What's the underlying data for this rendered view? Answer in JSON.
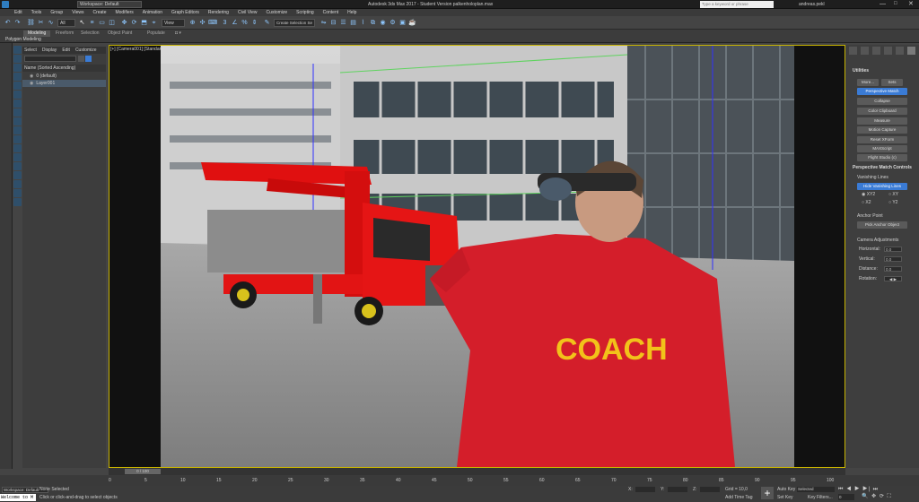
{
  "app": {
    "title": "Autodesk 3ds Max 2017 - Student Version    palkenholoplan.max",
    "workspace": "Workspace: Default",
    "search_placeholder": "Type a keyword or phrase",
    "user": "andreas.pekl"
  },
  "menu": [
    "Edit",
    "Tools",
    "Group",
    "Views",
    "Create",
    "Modifiers",
    "Animation",
    "Graph Editors",
    "Rendering",
    "Civil View",
    "Customize",
    "Scripting",
    "Content",
    "Help"
  ],
  "toolbar": {
    "filter": "All",
    "view": "View",
    "selection_set": "Create Selection Se"
  },
  "ribbon": {
    "tabs": [
      "Modeling",
      "Freeform",
      "Selection",
      "Object Paint",
      "Populate"
    ],
    "sub": "Polygon Modeling"
  },
  "scene_explorer": {
    "menu": [
      "Select",
      "Display",
      "Edit",
      "Customize"
    ],
    "header": "Name (Sorted Ascending)",
    "layers": [
      "0 (default)",
      "Layer001"
    ]
  },
  "viewport": {
    "label": "[+] [Camera001] [Standard] [Default Shading]",
    "hood_text": "COACH"
  },
  "command_panel": {
    "utilities_title": "Utilities",
    "more": "More...",
    "sets": "Sets",
    "buttons": [
      "Perspective Match",
      "Collapse",
      "Color Clipboard",
      "Measure",
      "Motion Capture",
      "Reset XForm",
      "MAXScript",
      "Flight Studio (c)"
    ],
    "pm_title": "Perspective Match Controls",
    "vanishing_lines": "Vanishing Lines",
    "hide_vanishing": "Hide Vanishing Lines",
    "axes": [
      "XY2",
      "XY",
      "X2",
      "Y2"
    ],
    "anchor_point": "Anchor Point",
    "pick_anchor": "Pick Anchor Object",
    "camera_adjust": "Camera Adjustments",
    "horizontal_label": "Horizontal:",
    "horizontal": "0.0",
    "vertical_label": "Vertical:",
    "vertical": "0.0",
    "distance_label": "Distance:",
    "distance": "0.0",
    "rotation_label": "Rotation:"
  },
  "timeline": {
    "frame": "0 / 100",
    "ticks": [
      "0",
      "5",
      "10",
      "15",
      "20",
      "25",
      "30",
      "35",
      "40",
      "45",
      "50",
      "55",
      "60",
      "65",
      "70",
      "75",
      "80",
      "85",
      "90",
      "95",
      "100"
    ]
  },
  "status": {
    "workspace": "Workspace: Default",
    "selection": "None Selected",
    "prompt": "Click or click-and-drag to select objects",
    "maxscript": "Welcome to M",
    "x_label": "X:",
    "x": "",
    "y_label": "Y:",
    "y": "",
    "z_label": "Z:",
    "z": "",
    "grid": "Grid = 10,0",
    "add_time_tag": "Add Time Tag",
    "auto_key": "Auto Key",
    "auto_key_val": "Selected",
    "set_key": "Set Key",
    "key_filters": "Key Filters...",
    "frame_field": "0"
  },
  "colors": {
    "accent": "#5aa0e6",
    "active_button": "#3a7bd5",
    "viewport_border": "#c8b400"
  }
}
